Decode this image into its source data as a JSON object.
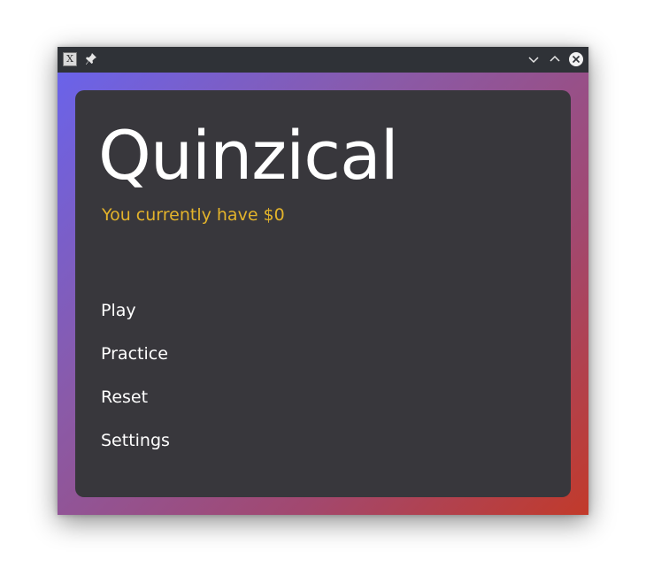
{
  "app": {
    "title": "Quinzical",
    "balance_text": "You currently have $0"
  },
  "menu": {
    "items": [
      {
        "label": "Play"
      },
      {
        "label": "Practice"
      },
      {
        "label": "Reset"
      },
      {
        "label": "Settings"
      }
    ]
  },
  "titlebar": {
    "icons": [
      "app-icon",
      "pin-icon",
      "minimize-icon",
      "maximize-icon",
      "close-icon"
    ]
  },
  "colors": {
    "panel": "#38373c",
    "accent_text": "#e3b32b",
    "gradient_start": "#6a63ea",
    "gradient_end": "#c23a2a",
    "titlebar": "#2f3237"
  }
}
